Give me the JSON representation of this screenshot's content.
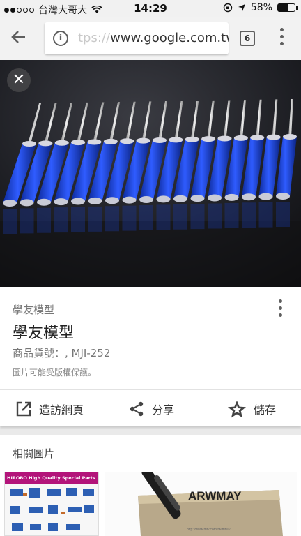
{
  "status_bar": {
    "carrier": "台灣大哥大",
    "time": "14:29",
    "battery": "58%",
    "battery_level": 0.58
  },
  "browser": {
    "url_faded": "tps://",
    "url_main": "www.google.com.tw",
    "tab_count": "6"
  },
  "image_result": {
    "source": "學友模型",
    "title": "學友模型",
    "description": "商品貨號：, MJI-252",
    "copyright_note": "圖片可能受版權保護。",
    "actions": {
      "visit": "造訪網頁",
      "share": "分享",
      "save": "儲存"
    }
  },
  "related": {
    "heading": "相關圖片",
    "thumb1_banner": "HIROBO High Quality Special Parts",
    "thumb2_brand": "ARWMAY"
  },
  "colors": {
    "handle_blue": "#1a3fcf",
    "chrome_bg": "#f2f2f2",
    "icon_gray": "#5f5f5f"
  }
}
